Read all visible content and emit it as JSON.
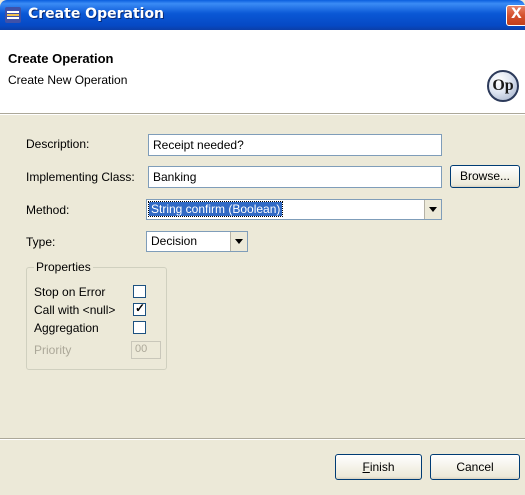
{
  "window": {
    "title": "Create Operation",
    "close_glyph": "X"
  },
  "header": {
    "title": "Create Operation",
    "subtitle": "Create New Operation",
    "badge_text": "Op",
    "badge_icon": "operation-badge-icon"
  },
  "form": {
    "description_label": "Description:",
    "description_value": "Receipt needed?",
    "implementing_class_label": "Implementing Class:",
    "implementing_class_value": "Banking",
    "browse_label": "Browse...",
    "method_label": "Method:",
    "method_value": "String confirm (Boolean)",
    "type_label": "Type:",
    "type_value": "Decision"
  },
  "properties": {
    "group_label": "Properties",
    "stop_on_error_label": "Stop on Error",
    "stop_on_error_checked": false,
    "call_with_null_label": "Call with <null>",
    "call_with_null_checked": true,
    "aggregation_label": "Aggregation",
    "aggregation_checked": false,
    "priority_label": "Priority",
    "priority_value": "00"
  },
  "footer": {
    "finish_label_mnemonic": "F",
    "finish_label_rest": "inish",
    "cancel_label": "Cancel"
  },
  "colors": {
    "titlebar": "#0a58d6",
    "dialog_bg": "#ece9d8",
    "selection": "#316ac5",
    "disabled_text": "#aca899"
  }
}
